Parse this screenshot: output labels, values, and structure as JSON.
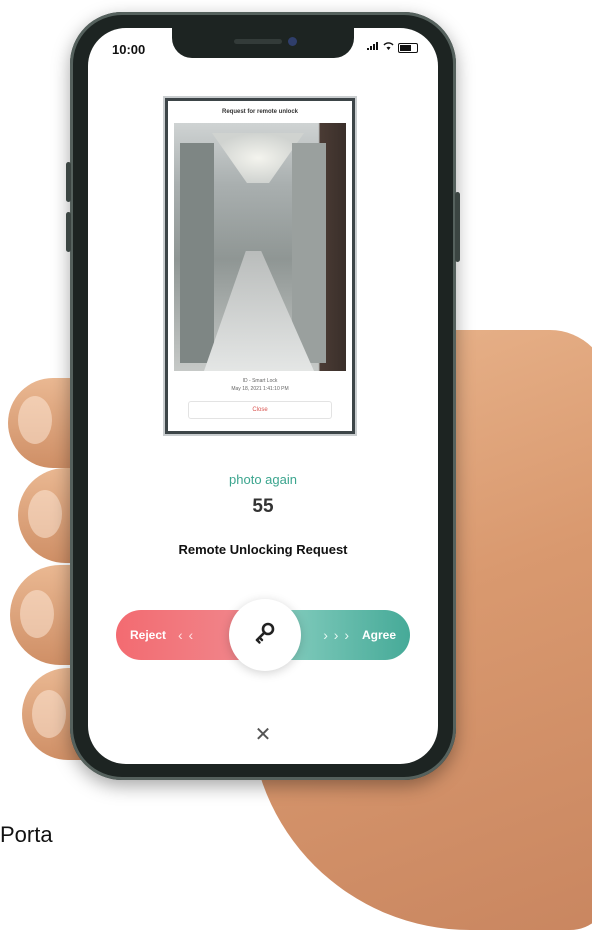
{
  "status_bar": {
    "time": "10:00"
  },
  "popup": {
    "title": "Request for remote unlock",
    "meta_line1": "ID - Smart Lock",
    "meta_line2": "May 18, 2021 1:41:10 PM",
    "close_label": "Close"
  },
  "photo_again_label": "photo again",
  "countdown": "55",
  "request_title": "Remote Unlocking Request",
  "slider": {
    "reject_label": "Reject",
    "reject_chevrons": "‹ ‹",
    "agree_chevrons": "› › ›",
    "agree_label": "Agree"
  },
  "dismiss_label": "✕",
  "caption": "Porta",
  "colors": {
    "accent_green": "#3ba58e",
    "reject_red": "#f36b71",
    "agree_teal": "#46aa98"
  },
  "icons": {
    "knob": "key-icon"
  }
}
